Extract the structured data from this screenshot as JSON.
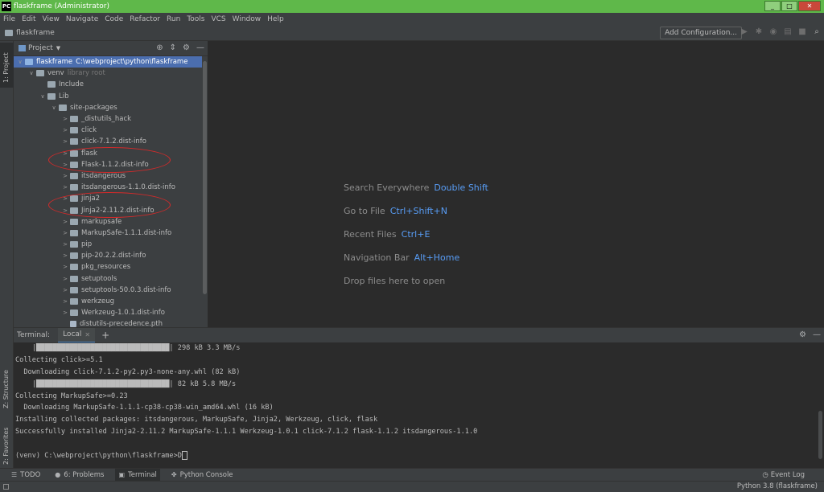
{
  "window": {
    "title": "flaskframe (Administrator)",
    "app_icon": "PC",
    "minimize": "_",
    "maximize": "□",
    "close": "✕"
  },
  "menu": [
    "File",
    "Edit",
    "View",
    "Navigate",
    "Code",
    "Refactor",
    "Run",
    "Tools",
    "VCS",
    "Window",
    "Help"
  ],
  "navbar": {
    "breadcrumb": "flaskframe",
    "add_configuration": "Add Configuration..."
  },
  "left_tabs": {
    "project": "1: Project",
    "structure": "Z: Structure",
    "favorites": "2: Favorites"
  },
  "project_panel": {
    "title": "Project",
    "tree": [
      {
        "label": "flaskframe",
        "path": "C:\\webproject\\python\\flaskframe",
        "expanded": true,
        "selected": true
      },
      {
        "label": "venv",
        "hint": "library root",
        "expanded": true
      },
      {
        "label": "Include"
      },
      {
        "label": "Lib",
        "expanded": true
      },
      {
        "label": "site-packages",
        "expanded": true
      },
      {
        "label": "_distutils_hack"
      },
      {
        "label": "click"
      },
      {
        "label": "click-7.1.2.dist-info"
      },
      {
        "label": "flask"
      },
      {
        "label": "Flask-1.1.2.dist-info"
      },
      {
        "label": "itsdangerous"
      },
      {
        "label": "itsdangerous-1.1.0.dist-info"
      },
      {
        "label": "jinja2"
      },
      {
        "label": "Jinja2-2.11.2.dist-info"
      },
      {
        "label": "markupsafe"
      },
      {
        "label": "MarkupSafe-1.1.1.dist-info"
      },
      {
        "label": "pip"
      },
      {
        "label": "pip-20.2.2.dist-info"
      },
      {
        "label": "pkg_resources"
      },
      {
        "label": "setuptools"
      },
      {
        "label": "setuptools-50.0.3.dist-info"
      },
      {
        "label": "werkzeug"
      },
      {
        "label": "Werkzeug-1.0.1.dist-info"
      },
      {
        "label": "distutils-precedence.pth"
      }
    ]
  },
  "editor_hints": [
    {
      "text": "Search Everywhere",
      "key": "Double Shift"
    },
    {
      "text": "Go to File",
      "key": "Ctrl+Shift+N"
    },
    {
      "text": "Recent Files",
      "key": "Ctrl+E"
    },
    {
      "text": "Navigation Bar",
      "key": "Alt+Home"
    },
    {
      "text": "Drop files here to open",
      "key": ""
    }
  ],
  "terminal": {
    "label": "Terminal:",
    "tab": "Local",
    "lines": [
      "    |████████████████████████████████| 298 kB 3.3 MB/s",
      "Collecting click>=5.1",
      "  Downloading click-7.1.2-py2.py3-none-any.whl (82 kB)",
      "    |████████████████████████████████| 82 kB 5.8 MB/s",
      "Collecting MarkupSafe>=0.23",
      "  Downloading MarkupSafe-1.1.1-cp38-cp38-win_amd64.whl (16 kB)",
      "Installing collected packages: itsdangerous, MarkupSafe, Jinja2, Werkzeug, click, flask",
      "Successfully installed Jinja2-2.11.2 MarkupSafe-1.1.1 Werkzeug-1.0.1 click-7.1.2 flask-1.1.2 itsdangerous-1.1.0",
      ""
    ],
    "prompt": "(venv) C:\\webproject\\python\\flaskframe>D"
  },
  "bottom_tabs": [
    {
      "icon": "☰",
      "label": "TODO"
    },
    {
      "icon": "●",
      "label": "6: Problems"
    },
    {
      "icon": "▣",
      "label": "Terminal"
    },
    {
      "icon": "✤",
      "label": "Python Console"
    }
  ],
  "event_log": "Event Log",
  "status": {
    "interpreter": "Python 3.8 (flaskframe)"
  },
  "colors": {
    "titlebar": "#5fb84a",
    "selection": "#4b6eaf",
    "highlight_oval": "#d42a2a",
    "link_key": "#589df6"
  }
}
